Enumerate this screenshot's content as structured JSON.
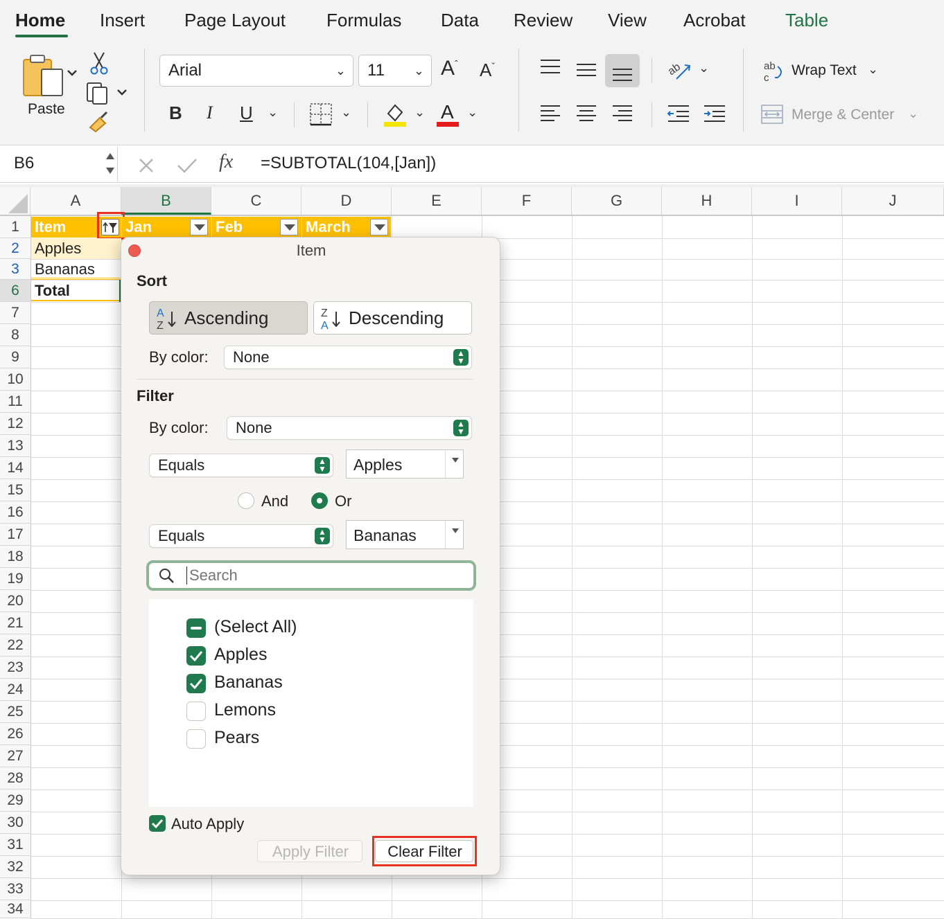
{
  "ribbon": {
    "tabs": [
      {
        "label": "Home",
        "active": true
      },
      {
        "label": "Insert"
      },
      {
        "label": "Page Layout"
      },
      {
        "label": "Formulas"
      },
      {
        "label": "Data"
      },
      {
        "label": "Review"
      },
      {
        "label": "View"
      },
      {
        "label": "Acrobat"
      },
      {
        "label": "Table"
      }
    ],
    "paste_label": "Paste",
    "font_name": "Arial",
    "font_size": "11",
    "wrap_text_label": "Wrap Text",
    "merge_center_label": "Merge & Center",
    "accent_color": "#217346"
  },
  "formula_bar": {
    "cell_ref": "B6",
    "formula": "=SUBTOTAL(104,[Jan])"
  },
  "sheet": {
    "columns": [
      "A",
      "B",
      "C",
      "D",
      "E",
      "F",
      "G",
      "H",
      "I",
      "J"
    ],
    "rows": [
      "1",
      "2",
      "3",
      "6",
      "7",
      "8",
      "9",
      "10",
      "11",
      "12",
      "13",
      "14",
      "15",
      "16",
      "17",
      "18",
      "19",
      "20",
      "21",
      "22",
      "23",
      "24",
      "25",
      "26",
      "27",
      "28",
      "29",
      "30",
      "31",
      "32",
      "33",
      "34"
    ],
    "headers": [
      "Item",
      "Jan",
      "Feb",
      "March"
    ],
    "cells": {
      "a2": "Apples",
      "a3": "Bananas",
      "a6": "Total"
    },
    "header_fill": "#ffc000"
  },
  "filter_popup": {
    "title": "Item",
    "sort_heading": "Sort",
    "ascending_label": "Ascending",
    "descending_label": "Descending",
    "sort_by_color_label": "By color:",
    "sort_by_color_value": "None",
    "filter_heading": "Filter",
    "filter_by_color_label": "By color:",
    "filter_by_color_value": "None",
    "condition1_op": "Equals",
    "condition1_value": "Apples",
    "and_label": "And",
    "or_label": "Or",
    "or_selected": true,
    "condition2_op": "Equals",
    "condition2_value": "Bananas",
    "search_placeholder": "Search",
    "list": [
      {
        "label": "(Select All)",
        "state": "mixed"
      },
      {
        "label": "Apples",
        "state": "checked"
      },
      {
        "label": "Bananas",
        "state": "checked"
      },
      {
        "label": "Lemons",
        "state": "unchecked"
      },
      {
        "label": "Pears",
        "state": "unchecked"
      }
    ],
    "auto_apply_label": "Auto Apply",
    "auto_apply_checked": true,
    "apply_filter_label": "Apply Filter",
    "clear_filter_label": "Clear Filter"
  }
}
